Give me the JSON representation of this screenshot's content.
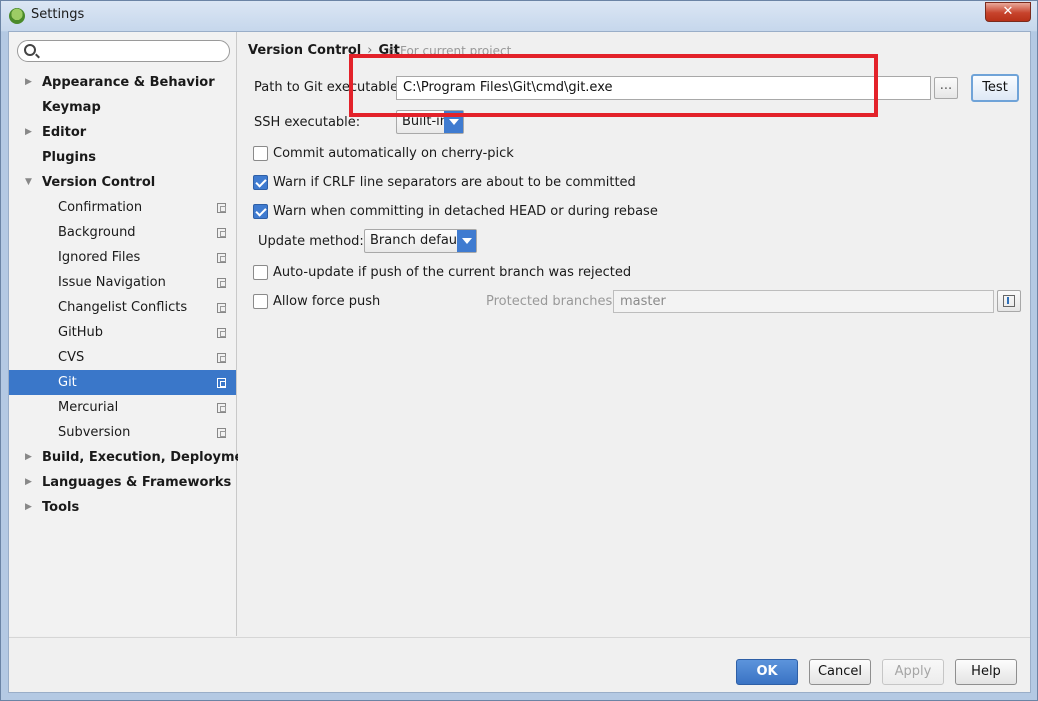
{
  "window": {
    "title": "Settings",
    "close_glyph": "✕"
  },
  "search": {
    "placeholder": "",
    "value": ""
  },
  "sidebar": {
    "items": [
      {
        "label": "Appearance & Behavior",
        "level": "top",
        "expandable": true
      },
      {
        "label": "Keymap",
        "level": "top",
        "expandable": false
      },
      {
        "label": "Editor",
        "level": "top",
        "expandable": true
      },
      {
        "label": "Plugins",
        "level": "top",
        "expandable": false
      },
      {
        "label": "Version Control",
        "level": "top",
        "expandable": true,
        "expanded": true
      },
      {
        "label": "Confirmation",
        "level": "child"
      },
      {
        "label": "Background",
        "level": "child"
      },
      {
        "label": "Ignored Files",
        "level": "child"
      },
      {
        "label": "Issue Navigation",
        "level": "child"
      },
      {
        "label": "Changelist Conflicts",
        "level": "child"
      },
      {
        "label": "GitHub",
        "level": "child"
      },
      {
        "label": "CVS",
        "level": "child"
      },
      {
        "label": "Git",
        "level": "child",
        "selected": true
      },
      {
        "label": "Mercurial",
        "level": "child"
      },
      {
        "label": "Subversion",
        "level": "child"
      },
      {
        "label": "Build, Execution, Deployment",
        "level": "top",
        "expandable": true
      },
      {
        "label": "Languages & Frameworks",
        "level": "top",
        "expandable": true
      },
      {
        "label": "Tools",
        "level": "top",
        "expandable": true
      }
    ]
  },
  "header": {
    "breadcrumb_parent": "Version Control",
    "breadcrumb_sep": "›",
    "breadcrumb_current": "Git",
    "for_project": "For current project"
  },
  "git": {
    "path_label": "Path to Git executable:",
    "path_value": "C:\\Program Files\\Git\\cmd\\git.exe",
    "browse_label": "...",
    "test_label": "Test",
    "ssh_label": "SSH executable:",
    "ssh_value": "Built-in",
    "opt_cherry_pick": "Commit automatically on cherry-pick",
    "opt_crlf": "Warn if CRLF line separators are about to be committed",
    "opt_detached": "Warn when committing in detached HEAD or during rebase",
    "update_method_label": "Update method:",
    "update_method_value": "Branch default",
    "opt_auto_update": "Auto-update if push of the current branch was rejected",
    "opt_force_push": "Allow force push",
    "protected_label": "Protected branches:",
    "protected_value": "master",
    "checks": {
      "cherry_pick": false,
      "crlf": true,
      "detached": true,
      "auto_update": false,
      "force_push": false
    }
  },
  "footer": {
    "ok": "OK",
    "cancel": "Cancel",
    "apply": "Apply",
    "help": "Help"
  },
  "colors": {
    "selection": "#3a77c9",
    "highlight_box": "#e3222a",
    "accent": "#3f7bd0"
  }
}
